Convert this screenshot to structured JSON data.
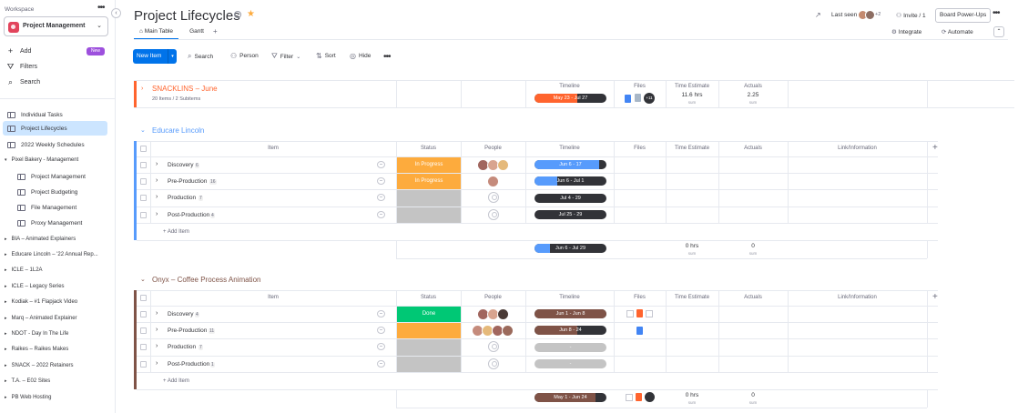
{
  "workspace": {
    "label": "Workspace",
    "name": "Project Management",
    "actions": [
      {
        "icon": "plus-icon",
        "label": "Add"
      },
      {
        "icon": "filter-icon",
        "label": "Filters"
      },
      {
        "icon": "search-icon",
        "label": "Search"
      }
    ],
    "new_badge": "New",
    "boards": [
      {
        "label": "Individual Tasks"
      },
      {
        "label": "Project Lifecycles",
        "active": true
      },
      {
        "label": "2022 Weekly Schedules"
      }
    ],
    "folder_open": {
      "label": "Pixel Bakery - Management",
      "children": [
        "Project Management",
        "Project Budgeting",
        "File Management",
        "Proxy Management"
      ]
    },
    "folders": [
      "BIA – Animated Explainers",
      "Educare Lincoln – '22 Annual Rep...",
      "ICLE – 1L2A",
      "ICLE – Legacy Series",
      "Kodiak – #1 Flapjack Video",
      "Marq – Animated Explainer",
      "NDOT - Day In The Life",
      "Raikes – Raikes Makes",
      "SNACK – 2022 Retainers",
      "T.A. – E02 Sites",
      "PB Web Hosting"
    ]
  },
  "header": {
    "title": "Project Lifecycles",
    "last_seen": "Last seen",
    "last_seen_more": "+2",
    "invite": "Invite / 1",
    "power_ups": "Board Power-Ups",
    "tabs": [
      "Main Table",
      "Gantt"
    ],
    "integrate": "Integrate",
    "automate": "Automate"
  },
  "toolbar": {
    "new_item": "New Item",
    "search": "Search",
    "person": "Person",
    "filter": "Filter",
    "sort": "Sort",
    "hide": "Hide"
  },
  "columns": {
    "item": "Item",
    "status": "Status",
    "people": "People",
    "timeline": "Timeline",
    "files": "Files",
    "time_estimate": "Time Estimate",
    "actuals": "Actuals",
    "link": "Link/Information"
  },
  "collapsed_group": {
    "title": "SNACKLINS – June",
    "subtitle": "20 Items / 2 Subitems",
    "color": "#ff642e",
    "timeline": "May 23 - Jul 27",
    "time_estimate": "11.6 hrs",
    "actuals": "2.25",
    "sum_label": "sum",
    "files_more": "+11"
  },
  "groups": [
    {
      "title": "Educare Lincoln",
      "color": "#579bfc",
      "rows": [
        {
          "name": "Discovery",
          "count": "6",
          "status": "In Progress",
          "status_color": "#fdab3d",
          "timeline": "Jun 6 - 17",
          "people": 3
        },
        {
          "name": "Pre-Production",
          "count": "16",
          "status": "In Progress",
          "status_color": "#fdab3d",
          "timeline": "Jun 6 - Jul 1",
          "people": 1
        },
        {
          "name": "Production",
          "count": "7",
          "status": "",
          "status_color": "#c4c4c4",
          "timeline": "Jul 4 - 29",
          "people": 0
        },
        {
          "name": "Post-Production",
          "count": "4",
          "status": "",
          "status_color": "#c4c4c4",
          "timeline": "Jul 25 - 29",
          "people": 0
        }
      ],
      "add_item": "+ Add Item",
      "summary": {
        "timeline": "Jun 6 - Jul 29",
        "time_estimate": "0 hrs",
        "actuals": "0",
        "sum_label": "sum"
      }
    },
    {
      "title": "Onyx – Coffee Process Animation",
      "color": "#7f5347",
      "rows": [
        {
          "name": "Discovery",
          "count": "4",
          "status": "Done",
          "status_color": "#00c875",
          "timeline": "Jun 1 - Jun 8",
          "people": 3
        },
        {
          "name": "Pre-Production",
          "count": "11",
          "status": "",
          "status_color": "#fdab3d",
          "timeline": "Jun 8 - 24",
          "people": 4
        },
        {
          "name": "Production",
          "count": "7",
          "status": "",
          "status_color": "#c4c4c4",
          "timeline": "-",
          "people": 0
        },
        {
          "name": "Post-Production",
          "count": "1",
          "status": "",
          "status_color": "#c4c4c4",
          "timeline": "-",
          "people": 0
        }
      ],
      "add_item": "+ Add Item",
      "summary": {
        "timeline": "May 1 - Jun 24",
        "time_estimate": "0 hrs",
        "actuals": "0",
        "sum_label": "sum"
      }
    }
  ]
}
